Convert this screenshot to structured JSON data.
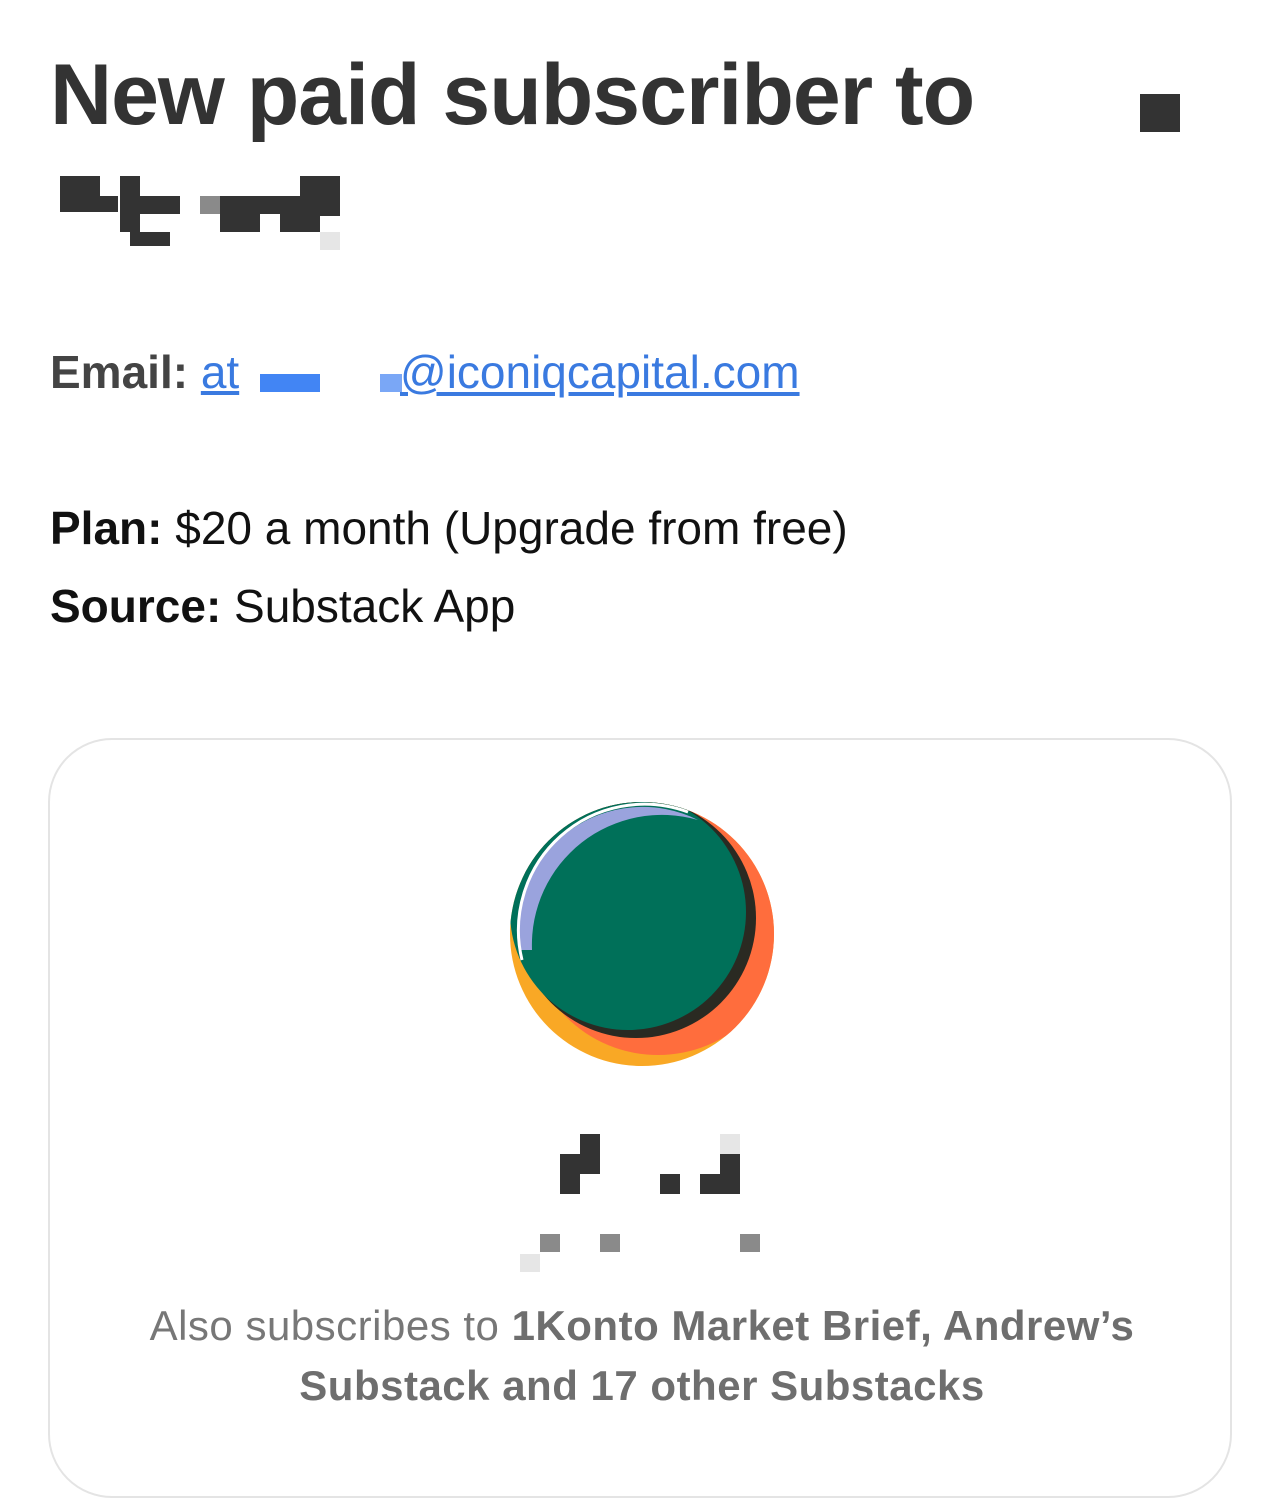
{
  "header": {
    "title": "New paid subscriber to"
  },
  "details": {
    "email_label": "Email:",
    "email_prefix": "at",
    "email_domain": "@iconiqcapital.com",
    "plan_label": "Plan:",
    "plan_value": "$20 a month (Upgrade from free)",
    "source_label": "Source:",
    "source_value": "Substack App"
  },
  "card": {
    "logo_icon": "publication-logo-icon",
    "colors": {
      "green": "#007059",
      "lavender": "#9aa3dd",
      "yellow": "#f9a825",
      "orange": "#ff6d3d",
      "dark": "#2a2a22"
    },
    "also_prefix": "Also subscribes to",
    "also_publications": "1Konto Market Brief, Andrew’s Substack and 17 other Substacks"
  }
}
